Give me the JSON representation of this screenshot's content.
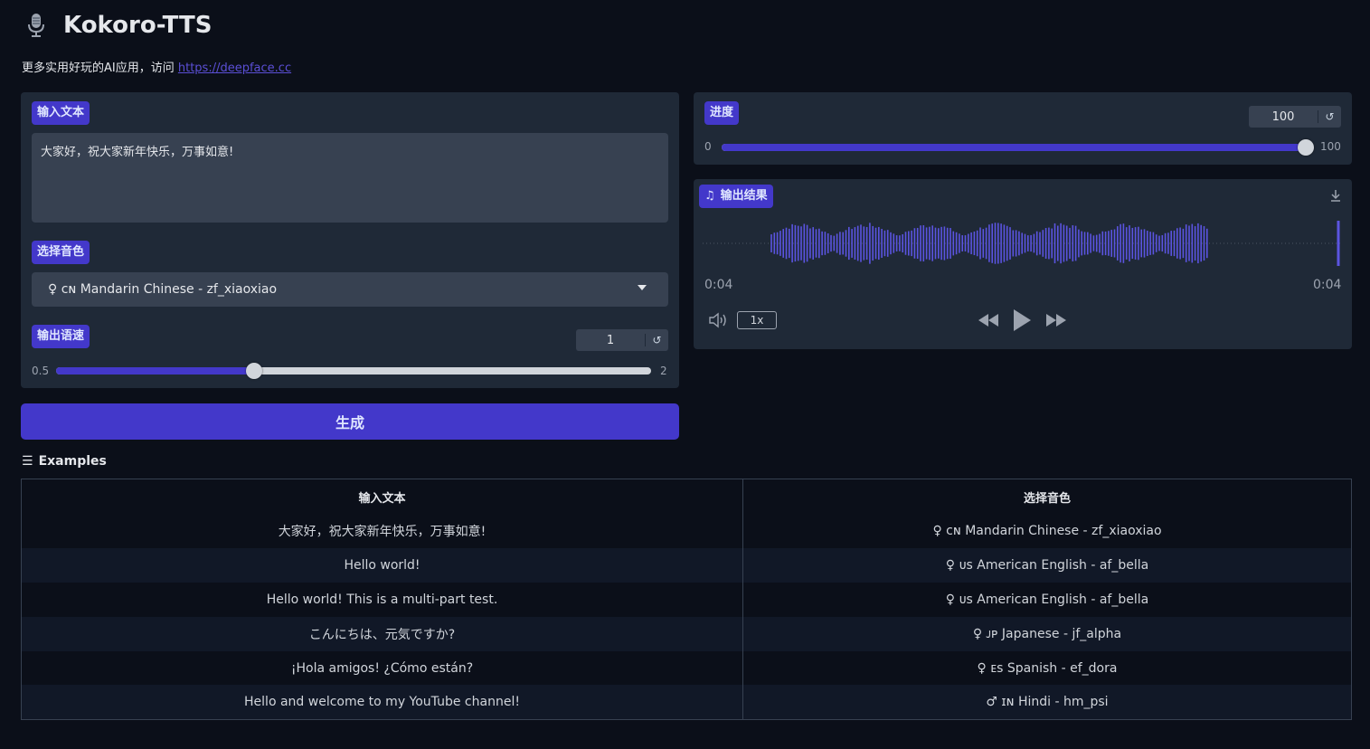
{
  "header": {
    "title": "Kokoro-TTS",
    "subtitle_prefix": "更多实用好玩的AI应用，访问",
    "subtitle_link": "https://deepface.cc"
  },
  "input_panel": {
    "text_label": "输入文本",
    "text_value": "大家好，祝大家新年快乐，万事如意!",
    "voice_label": "选择音色",
    "voice_value": "♀ ᴄɴ Mandarin Chinese - zf_xiaoxiao",
    "speed_label": "输出语速",
    "speed_value": "1",
    "speed_min": "0.5",
    "speed_max": "2",
    "speed_level": 0.333
  },
  "generate_button": "生成",
  "progress_panel": {
    "label": "进度",
    "value": "100",
    "min": "0",
    "max": "100",
    "level": 1.0
  },
  "output_panel": {
    "label": "输出结果",
    "time_current": "0:04",
    "time_total": "0:04",
    "speed": "1x"
  },
  "examples": {
    "title": "Examples",
    "headers": [
      "输入文本",
      "选择音色"
    ],
    "rows": [
      [
        "大家好，祝大家新年快乐，万事如意!",
        "♀ ᴄɴ Mandarin Chinese - zf_xiaoxiao"
      ],
      [
        "Hello world!",
        "♀ ᴜs American English - af_bella"
      ],
      [
        "Hello world! This is a multi-part test.",
        "♀ ᴜs American English - af_bella"
      ],
      [
        "こんにちは、元気ですか?",
        "♀ ᴊᴘ Japanese - jf_alpha"
      ],
      [
        "¡Hola amigos! ¿Cómo están?",
        "♀ ᴇs Spanish - ef_dora"
      ],
      [
        "Hello and welcome to my YouTube channel!",
        "♂ ɪɴ Hindi - hm_psi"
      ]
    ]
  },
  "colors": {
    "accent": "#4338ca",
    "background": "#0b0f19",
    "panel": "#1f2937",
    "input": "#374151",
    "waveform": "#5b54e0"
  }
}
